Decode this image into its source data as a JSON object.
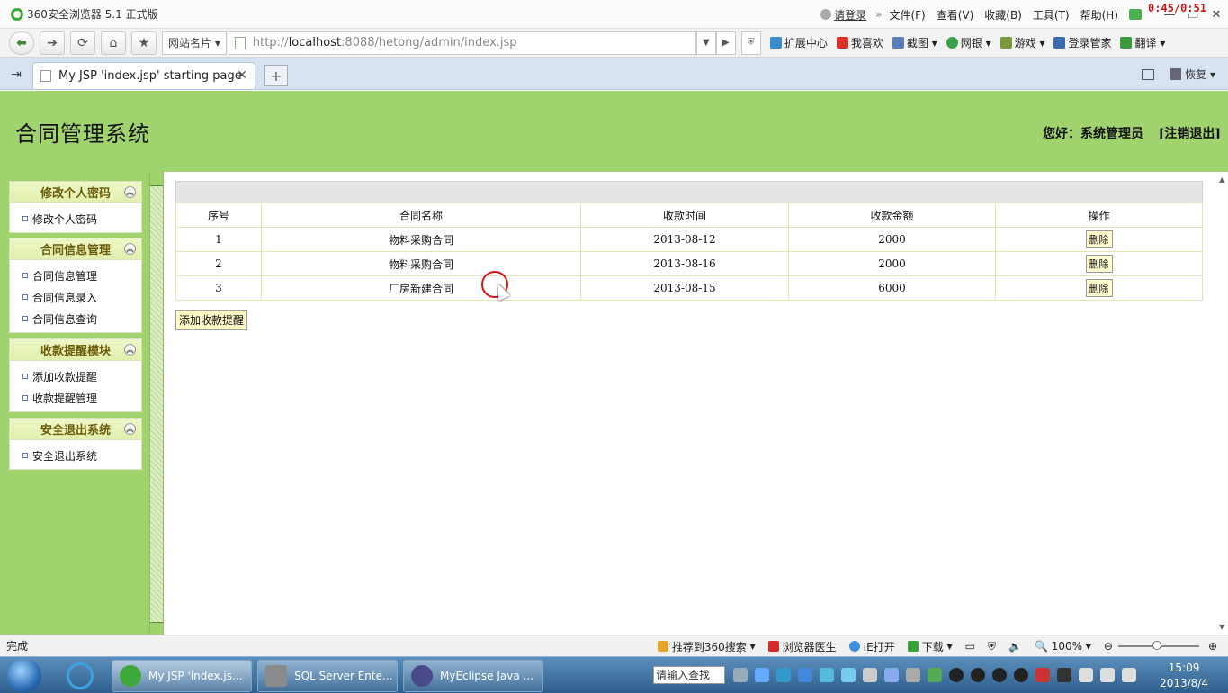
{
  "browser": {
    "app_title": "360安全浏览器 5.1 正式版",
    "login": "请登录",
    "menu": [
      "文件(F)",
      "查看(V)",
      "收藏(B)",
      "工具(T)",
      "帮助(H)"
    ],
    "timer": "0:45/0:51",
    "site_select": "网站名片",
    "url_prefix": "http://",
    "url_host": "localhost",
    "url_rest": ":8088/hetong/admin/index.jsp",
    "toolbar": [
      "扩展中心",
      "我喜欢",
      "截图",
      "网银",
      "游戏",
      "登录管家",
      "翻译"
    ],
    "tab_title": "My JSP 'index.jsp' starting page",
    "restore": "恢复"
  },
  "header": {
    "title": "合同管理系统",
    "greeting": "您好：系统管理员",
    "logout": "[注销退出]"
  },
  "sidebar": [
    {
      "title": "修改个人密码",
      "items": [
        "修改个人密码"
      ]
    },
    {
      "title": "合同信息管理",
      "items": [
        "合同信息管理",
        "合同信息录入",
        "合同信息查询"
      ]
    },
    {
      "title": "收款提醒模块",
      "items": [
        "添加收款提醒",
        "收款提醒管理"
      ]
    },
    {
      "title": "安全退出系统",
      "items": [
        "安全退出系统"
      ]
    }
  ],
  "table": {
    "columns": [
      "序号",
      "合同名称",
      "收款时间",
      "收款金额",
      "操作"
    ],
    "rows": [
      [
        "1",
        "物料采购合同",
        "2013-08-12",
        "2000"
      ],
      [
        "2",
        "物料采购合同",
        "2013-08-16",
        "2000"
      ],
      [
        "3",
        "厂房新建合同",
        "2013-08-15",
        "6000"
      ]
    ],
    "delete_label": "删除",
    "add_button": "添加收款提醒"
  },
  "statusbar": {
    "status": "完成",
    "items": [
      "推荐到360搜索",
      "浏览器医生",
      "IE打开",
      "下载"
    ],
    "zoom": "100%"
  },
  "taskbar": {
    "tasks": [
      "My JSP 'index.js...",
      "SQL Server Ente...",
      "MyEclipse Java ..."
    ],
    "search_placeholder": "请输入查找",
    "time": "15:09",
    "date": "2013/8/4"
  },
  "colors": {
    "header_green": "#a0d26e",
    "menu_header_text": "#6b5c08",
    "button_yellow": "#fffcd0"
  }
}
